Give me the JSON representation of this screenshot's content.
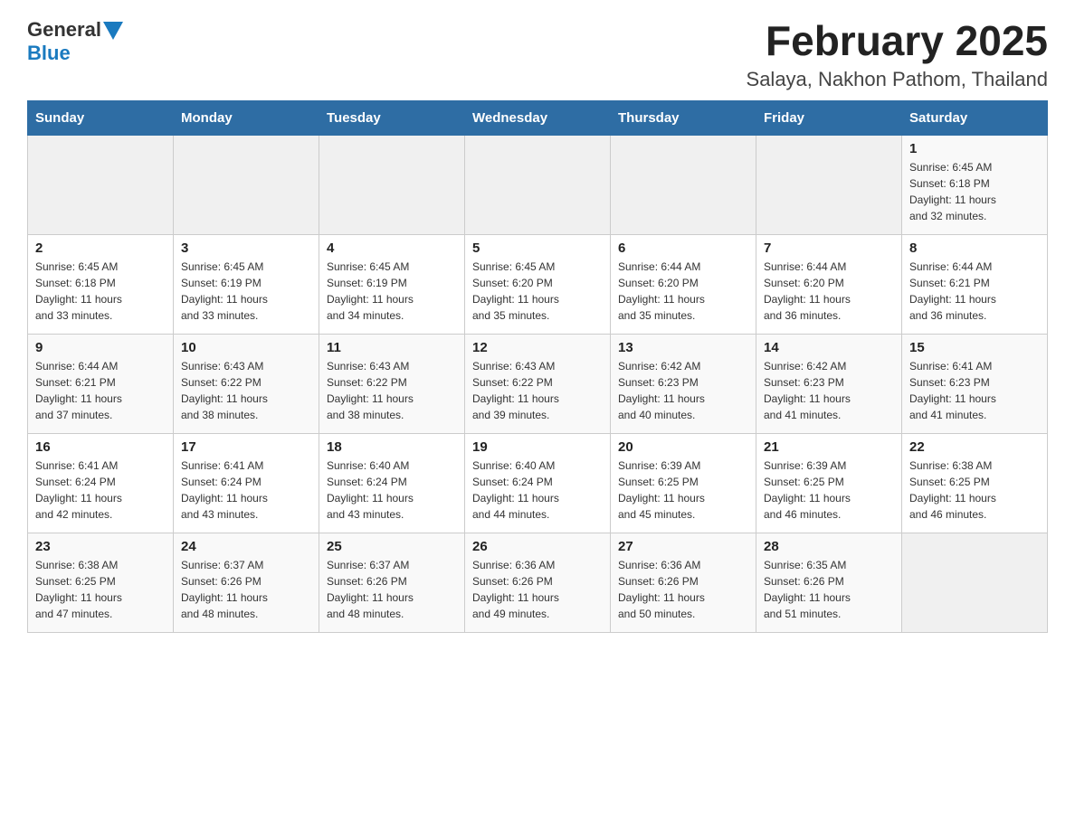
{
  "header": {
    "logo_general": "General",
    "logo_blue": "Blue",
    "title": "February 2025",
    "subtitle": "Salaya, Nakhon Pathom, Thailand"
  },
  "calendar": {
    "days_of_week": [
      "Sunday",
      "Monday",
      "Tuesday",
      "Wednesday",
      "Thursday",
      "Friday",
      "Saturday"
    ],
    "weeks": [
      [
        {
          "day": "",
          "info": ""
        },
        {
          "day": "",
          "info": ""
        },
        {
          "day": "",
          "info": ""
        },
        {
          "day": "",
          "info": ""
        },
        {
          "day": "",
          "info": ""
        },
        {
          "day": "",
          "info": ""
        },
        {
          "day": "1",
          "info": "Sunrise: 6:45 AM\nSunset: 6:18 PM\nDaylight: 11 hours\nand 32 minutes."
        }
      ],
      [
        {
          "day": "2",
          "info": "Sunrise: 6:45 AM\nSunset: 6:18 PM\nDaylight: 11 hours\nand 33 minutes."
        },
        {
          "day": "3",
          "info": "Sunrise: 6:45 AM\nSunset: 6:19 PM\nDaylight: 11 hours\nand 33 minutes."
        },
        {
          "day": "4",
          "info": "Sunrise: 6:45 AM\nSunset: 6:19 PM\nDaylight: 11 hours\nand 34 minutes."
        },
        {
          "day": "5",
          "info": "Sunrise: 6:45 AM\nSunset: 6:20 PM\nDaylight: 11 hours\nand 35 minutes."
        },
        {
          "day": "6",
          "info": "Sunrise: 6:44 AM\nSunset: 6:20 PM\nDaylight: 11 hours\nand 35 minutes."
        },
        {
          "day": "7",
          "info": "Sunrise: 6:44 AM\nSunset: 6:20 PM\nDaylight: 11 hours\nand 36 minutes."
        },
        {
          "day": "8",
          "info": "Sunrise: 6:44 AM\nSunset: 6:21 PM\nDaylight: 11 hours\nand 36 minutes."
        }
      ],
      [
        {
          "day": "9",
          "info": "Sunrise: 6:44 AM\nSunset: 6:21 PM\nDaylight: 11 hours\nand 37 minutes."
        },
        {
          "day": "10",
          "info": "Sunrise: 6:43 AM\nSunset: 6:22 PM\nDaylight: 11 hours\nand 38 minutes."
        },
        {
          "day": "11",
          "info": "Sunrise: 6:43 AM\nSunset: 6:22 PM\nDaylight: 11 hours\nand 38 minutes."
        },
        {
          "day": "12",
          "info": "Sunrise: 6:43 AM\nSunset: 6:22 PM\nDaylight: 11 hours\nand 39 minutes."
        },
        {
          "day": "13",
          "info": "Sunrise: 6:42 AM\nSunset: 6:23 PM\nDaylight: 11 hours\nand 40 minutes."
        },
        {
          "day": "14",
          "info": "Sunrise: 6:42 AM\nSunset: 6:23 PM\nDaylight: 11 hours\nand 41 minutes."
        },
        {
          "day": "15",
          "info": "Sunrise: 6:41 AM\nSunset: 6:23 PM\nDaylight: 11 hours\nand 41 minutes."
        }
      ],
      [
        {
          "day": "16",
          "info": "Sunrise: 6:41 AM\nSunset: 6:24 PM\nDaylight: 11 hours\nand 42 minutes."
        },
        {
          "day": "17",
          "info": "Sunrise: 6:41 AM\nSunset: 6:24 PM\nDaylight: 11 hours\nand 43 minutes."
        },
        {
          "day": "18",
          "info": "Sunrise: 6:40 AM\nSunset: 6:24 PM\nDaylight: 11 hours\nand 43 minutes."
        },
        {
          "day": "19",
          "info": "Sunrise: 6:40 AM\nSunset: 6:24 PM\nDaylight: 11 hours\nand 44 minutes."
        },
        {
          "day": "20",
          "info": "Sunrise: 6:39 AM\nSunset: 6:25 PM\nDaylight: 11 hours\nand 45 minutes."
        },
        {
          "day": "21",
          "info": "Sunrise: 6:39 AM\nSunset: 6:25 PM\nDaylight: 11 hours\nand 46 minutes."
        },
        {
          "day": "22",
          "info": "Sunrise: 6:38 AM\nSunset: 6:25 PM\nDaylight: 11 hours\nand 46 minutes."
        }
      ],
      [
        {
          "day": "23",
          "info": "Sunrise: 6:38 AM\nSunset: 6:25 PM\nDaylight: 11 hours\nand 47 minutes."
        },
        {
          "day": "24",
          "info": "Sunrise: 6:37 AM\nSunset: 6:26 PM\nDaylight: 11 hours\nand 48 minutes."
        },
        {
          "day": "25",
          "info": "Sunrise: 6:37 AM\nSunset: 6:26 PM\nDaylight: 11 hours\nand 48 minutes."
        },
        {
          "day": "26",
          "info": "Sunrise: 6:36 AM\nSunset: 6:26 PM\nDaylight: 11 hours\nand 49 minutes."
        },
        {
          "day": "27",
          "info": "Sunrise: 6:36 AM\nSunset: 6:26 PM\nDaylight: 11 hours\nand 50 minutes."
        },
        {
          "day": "28",
          "info": "Sunrise: 6:35 AM\nSunset: 6:26 PM\nDaylight: 11 hours\nand 51 minutes."
        },
        {
          "day": "",
          "info": ""
        }
      ]
    ]
  }
}
